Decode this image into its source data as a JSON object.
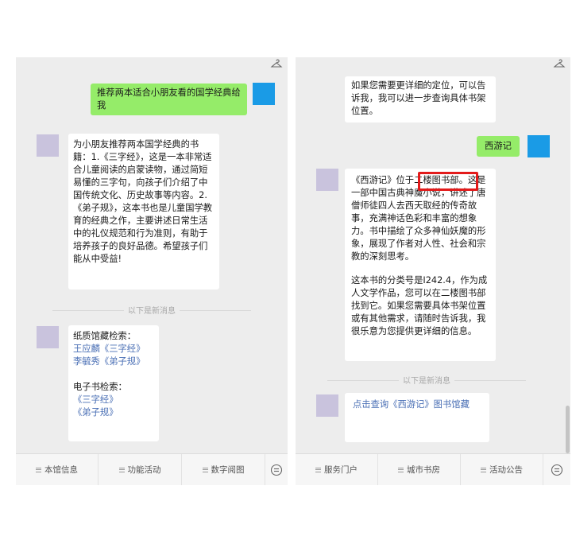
{
  "left": {
    "user_message": "推荐两本适合小朋友看的国学经典给我",
    "bot_reply": "为小朋友推荐两本国学经典的书籍：1.《三字经》，这是一本非常适合儿童阅读的启蒙读物，通过简短易懂的三字句，向孩子们介绍了中国传统文化、历史故事等内容。2.《弟子规》，这本书也是儿童国学教育的经典之作，主要讲述日常生活中的礼仪规范和行为准则，有助于培养孩子的良好品德。希望孩子们能从中受益!",
    "divider": "以下是新消息",
    "catalog": {
      "paper_heading": "纸质馆藏检索：",
      "paper_links": [
        "王应麟《三字经》",
        "李毓秀《弟子规》"
      ],
      "ebook_heading": "电子书检索：",
      "ebook_links": [
        "《三字经》",
        "《弟子规》"
      ]
    },
    "menu": [
      "本馆信息",
      "功能活动",
      "数字阅图"
    ]
  },
  "right": {
    "prev_bot_tail": "如果您需要更详细的定位，可以告诉我，我可以进一步查询具体书架位置。",
    "user_message": "西游记",
    "bot_reply_p1": "《西游记》位于二楼图书部。这是一部中国古典神魔小说，讲述了唐僧师徒四人去西天取经的传奇故事，充满神话色彩和丰富的想象力。书中描绘了众多神仙妖魔的形象，展现了作者对人性、社会和宗教的深刻思考。",
    "bot_reply_p2": "这本书的分类号是I242.4，作为成人文学作品，您可以在二楼图书部找到它。如果您需要具体书架位置或有其他需求，请随时告诉我，我很乐意为您提供更详细的信息。",
    "divider": "以下是新消息",
    "query_link": "点击查询《西游记》图书馆藏",
    "menu": [
      "服务门户",
      "城市书房",
      "活动公告"
    ]
  },
  "colors": {
    "green_bubble": "#95ec69",
    "user_avatar": "#1a9be6",
    "bot_avatar": "#c9c3dd",
    "link": "#4a6fb5",
    "highlight": "#e31b1b"
  },
  "icons": {
    "top": "hanger-icon",
    "menu": "menu-icon",
    "bar_end": "robot-icon"
  }
}
